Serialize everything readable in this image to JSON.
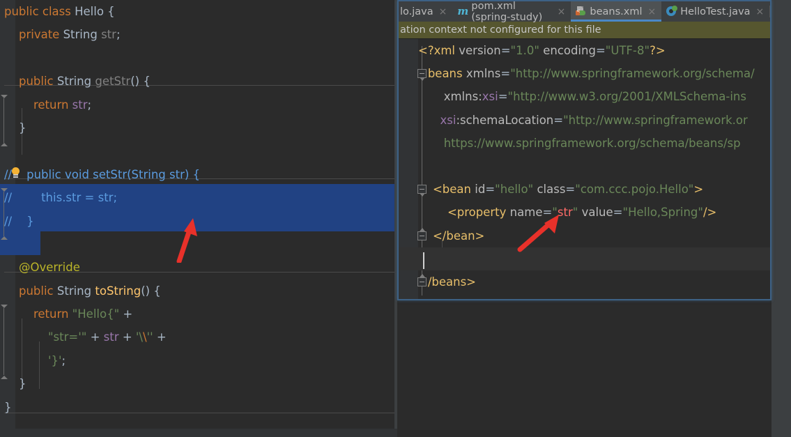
{
  "app": {
    "theme": "darcula",
    "accent_blue": "#4a88c7",
    "selection_blue": "#214283",
    "editor_bg": "#2b2b2b",
    "gutter_bg": "#313335",
    "chrome_bg": "#3c3f41",
    "warning_bg": "#56562f",
    "annotation_red": "#e8312a"
  },
  "tabs": [
    {
      "label": "lo.java",
      "icon": "java-file-icon",
      "active": false,
      "truncated": true,
      "close_label": "×"
    },
    {
      "label": "pom.xml (spring-study)",
      "icon": "maven-icon",
      "active": false,
      "close_label": "×"
    },
    {
      "label": "beans.xml",
      "icon": "spring-xml-icon",
      "active": true,
      "close_label": "×"
    },
    {
      "label": "HelloTest.java",
      "icon": "junit-test-icon",
      "active": false,
      "close_label": "×"
    }
  ],
  "warning_banner": {
    "text": "ation context not configured for this file",
    "full_text_implied": "Application context not configured for this file"
  },
  "left_editor": {
    "file": "Hello.java",
    "lines": [
      {
        "indent": 0,
        "tokens": [
          {
            "t": "public ",
            "c": "c-kw"
          },
          {
            "t": "class ",
            "c": "c-kw"
          },
          {
            "t": "Hello",
            "c": "c-type"
          },
          {
            "t": " {",
            "c": "c-plain"
          }
        ]
      },
      {
        "indent": 1,
        "tokens": [
          {
            "t": "private ",
            "c": "c-kw"
          },
          {
            "t": "String ",
            "c": "c-type"
          },
          {
            "t": "str",
            "c": "c-cmt"
          },
          {
            "t": ";",
            "c": "c-plain"
          }
        ]
      },
      {
        "indent": 0,
        "tokens": []
      },
      {
        "indent": 1,
        "tokens": [
          {
            "t": "public ",
            "c": "c-kw"
          },
          {
            "t": "String ",
            "c": "c-type"
          },
          {
            "t": "getStr",
            "c": "c-cmt"
          },
          {
            "t": "() {",
            "c": "c-plain"
          }
        ]
      },
      {
        "indent": 2,
        "tokens": [
          {
            "t": "return ",
            "c": "c-kw"
          },
          {
            "t": "str",
            "c": "c-field"
          },
          {
            "t": ";",
            "c": "c-plain"
          }
        ]
      },
      {
        "indent": 1,
        "tokens": [
          {
            "t": "}",
            "c": "c-plain"
          }
        ]
      },
      {
        "indent": 0,
        "tokens": []
      },
      {
        "indent": 0,
        "selected": true,
        "tokens": [
          {
            "t": "//",
            "c": "c-sel"
          },
          {
            "t": "    public void setStr(String str) {",
            "c": "c-sel"
          }
        ]
      },
      {
        "indent": 0,
        "selected": true,
        "tokens": [
          {
            "t": "//",
            "c": "c-sel"
          },
          {
            "t": "        this.str = str;",
            "c": "c-sel"
          }
        ]
      },
      {
        "indent": 0,
        "selected": true,
        "tokens": [
          {
            "t": "//",
            "c": "c-sel"
          },
          {
            "t": "    }",
            "c": "c-sel"
          }
        ]
      },
      {
        "indent": 0,
        "tokens": []
      },
      {
        "indent": 1,
        "tokens": [
          {
            "t": "@Override",
            "c": "c-ann"
          }
        ]
      },
      {
        "indent": 1,
        "tokens": [
          {
            "t": "public ",
            "c": "c-kw"
          },
          {
            "t": "String ",
            "c": "c-type"
          },
          {
            "t": "toString",
            "c": "c-meth"
          },
          {
            "t": "() {",
            "c": "c-plain"
          }
        ]
      },
      {
        "indent": 2,
        "tokens": [
          {
            "t": "return ",
            "c": "c-kw"
          },
          {
            "t": "\"Hello{\"",
            "c": "c-str"
          },
          {
            "t": " +",
            "c": "c-plain"
          }
        ]
      },
      {
        "indent": 3,
        "tokens": [
          {
            "t": "\"str='\"",
            "c": "c-str"
          },
          {
            "t": " + ",
            "c": "c-plain"
          },
          {
            "t": "str",
            "c": "c-field"
          },
          {
            "t": " + ",
            "c": "c-plain"
          },
          {
            "t": "'\\",
            "c": "c-str"
          },
          {
            "t": "\\",
            "c": "c-esc"
          },
          {
            "t": "''",
            "c": "c-str"
          },
          {
            "t": " +",
            "c": "c-plain"
          }
        ]
      },
      {
        "indent": 3,
        "tokens": [
          {
            "t": "'}'",
            "c": "c-str"
          },
          {
            "t": ";",
            "c": "c-plain"
          }
        ]
      },
      {
        "indent": 1,
        "tokens": [
          {
            "t": "}",
            "c": "c-plain"
          }
        ]
      },
      {
        "indent": 0,
        "tokens": [
          {
            "t": "}",
            "c": "c-plain"
          }
        ]
      }
    ],
    "raw_text": [
      "public class Hello {",
      "    private String str;",
      "",
      "    public String getStr() {",
      "        return str;",
      "    }",
      "",
      "//    public void setStr(String str) {",
      "//        this.str = str;",
      "//    }",
      "",
      "    @Override",
      "    public String toString() {",
      "        return \"Hello{\" +",
      "                \"str='\" + str + '\\'' +",
      "                '}';",
      "    }",
      "}"
    ],
    "intention_bulb": "lightbulb-icon"
  },
  "xml_editor": {
    "file": "beans.xml",
    "lines": [
      {
        "row": 0,
        "fold": null,
        "tokens": [
          {
            "t": "<?xml ",
            "c": "c-tag"
          },
          {
            "t": "version",
            "c": "c-attr"
          },
          {
            "t": "=",
            "c": "c-plain"
          },
          {
            "t": "\"1.0\"",
            "c": "c-str"
          },
          {
            "t": " ",
            "c": "c-plain"
          },
          {
            "t": "encoding",
            "c": "c-attr"
          },
          {
            "t": "=",
            "c": "c-plain"
          },
          {
            "t": "\"UTF-8\"",
            "c": "c-str"
          },
          {
            "t": "?>",
            "c": "c-tag"
          }
        ]
      },
      {
        "row": 1,
        "fold": "down",
        "tokens": [
          {
            "t": "<beans ",
            "c": "c-tag"
          },
          {
            "t": "xmlns",
            "c": "c-attr"
          },
          {
            "t": "=",
            "c": "c-plain"
          },
          {
            "t": "\"http://www.springframework.org/schema/",
            "c": "c-str"
          }
        ]
      },
      {
        "row": 2,
        "fold": null,
        "tokens": [
          {
            "t": "       xmlns:",
            "c": "c-attr"
          },
          {
            "t": "xsi",
            "c": "c-ns"
          },
          {
            "t": "=",
            "c": "c-plain"
          },
          {
            "t": "\"http://www.w3.org/2001/XMLSchema-ins",
            "c": "c-str"
          }
        ]
      },
      {
        "row": 3,
        "fold": null,
        "tokens": [
          {
            "t": "      ",
            "c": "c-plain"
          },
          {
            "t": "xsi",
            "c": "c-ns"
          },
          {
            "t": ":schemaLocation",
            "c": "c-attr"
          },
          {
            "t": "=",
            "c": "c-plain"
          },
          {
            "t": "\"http://www.springframework.or",
            "c": "c-str"
          }
        ]
      },
      {
        "row": 4,
        "fold": null,
        "tokens": [
          {
            "t": "       https://www.springframework.org/schema/beans/sp",
            "c": "c-str"
          }
        ]
      },
      {
        "row": 5,
        "fold": null,
        "tokens": []
      },
      {
        "row": 6,
        "fold": "down",
        "tokens": [
          {
            "t": "    <bean ",
            "c": "c-tag"
          },
          {
            "t": "id",
            "c": "c-attr"
          },
          {
            "t": "=",
            "c": "c-plain"
          },
          {
            "t": "\"hello\"",
            "c": "c-str"
          },
          {
            "t": " ",
            "c": "c-plain"
          },
          {
            "t": "class",
            "c": "c-attr"
          },
          {
            "t": "=",
            "c": "c-plain"
          },
          {
            "t": "\"com.ccc.pojo.Hello\"",
            "c": "c-str"
          },
          {
            "t": ">",
            "c": "c-tag"
          }
        ]
      },
      {
        "row": 7,
        "fold": null,
        "tokens": [
          {
            "t": "        <property ",
            "c": "c-tag"
          },
          {
            "t": "name",
            "c": "c-attr"
          },
          {
            "t": "=",
            "c": "c-plain"
          },
          {
            "t": "\"",
            "c": "c-str"
          },
          {
            "t": "str",
            "c": "c-err"
          },
          {
            "t": "\"",
            "c": "c-str"
          },
          {
            "t": " ",
            "c": "c-plain"
          },
          {
            "t": "value",
            "c": "c-attr"
          },
          {
            "t": "=",
            "c": "c-plain"
          },
          {
            "t": "\"Hello,Spring\"",
            "c": "c-str"
          },
          {
            "t": "/>",
            "c": "c-tag"
          }
        ]
      },
      {
        "row": 8,
        "fold": "up",
        "tokens": [
          {
            "t": "    </bean>",
            "c": "c-tag"
          }
        ]
      },
      {
        "row": 9,
        "fold": null,
        "caret": true,
        "tokens": []
      },
      {
        "row": 10,
        "fold": "up",
        "tokens": [
          {
            "t": "</beans>",
            "c": "c-tag"
          }
        ]
      }
    ],
    "raw_text": [
      "<?xml version=\"1.0\" encoding=\"UTF-8\"?>",
      "<beans xmlns=\"http://www.springframework.org/schema/",
      "       xmlns:xsi=\"http://www.w3.org/2001/XMLSchema-ins",
      "       xsi:schemaLocation=\"http://www.springframework.or",
      "        https://www.springframework.org/schema/beans/sp",
      "",
      "    <bean id=\"hello\" class=\"com.ccc.pojo.Hello\">",
      "        <property name=\"str\" value=\"Hello,Spring\"/>",
      "    </bean>",
      "",
      "</beans>"
    ]
  },
  "annotations": [
    {
      "name": "arrow-pointing-to-commented-setter",
      "type": "red-arrow",
      "direction": "up-right"
    },
    {
      "name": "arrow-pointing-to-property-name",
      "type": "red-arrow",
      "direction": "up-right"
    }
  ]
}
